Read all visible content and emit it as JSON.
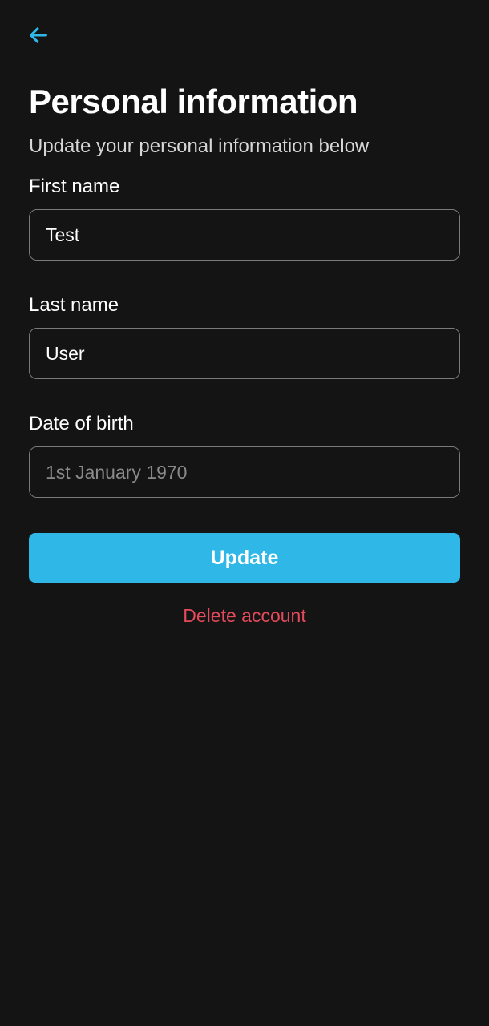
{
  "header": {
    "back_icon": "arrow-left"
  },
  "page": {
    "title": "Personal information",
    "subtitle": "Update your personal information below"
  },
  "form": {
    "first_name": {
      "label": "First name",
      "value": "Test"
    },
    "last_name": {
      "label": "Last name",
      "value": "User"
    },
    "date_of_birth": {
      "label": "Date of birth",
      "value": "1st January 1970"
    }
  },
  "actions": {
    "update_label": "Update",
    "delete_label": "Delete account"
  },
  "colors": {
    "background": "#141414",
    "accent": "#2fb7e8",
    "danger": "#e34a5a",
    "text": "#ffffff",
    "muted": "#8a8a8a",
    "border": "#7a7a7a"
  }
}
